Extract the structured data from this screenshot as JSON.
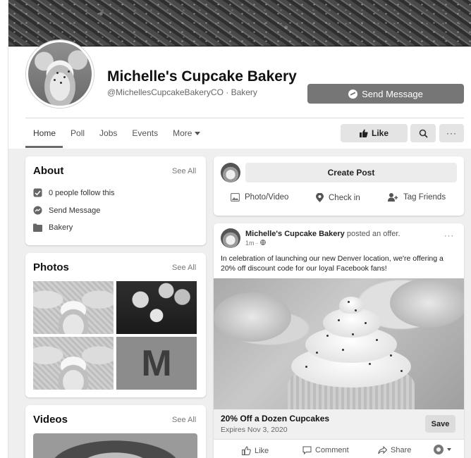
{
  "page": {
    "name": "Michelle's Cupcake Bakery",
    "handle_category": "@MichellesCupcakeBakeryCO · Bakery",
    "send_message": "Send Message"
  },
  "tabs": [
    "Home",
    "Poll",
    "Jobs",
    "Events",
    "More"
  ],
  "actions": {
    "like": "Like",
    "more": "···"
  },
  "about": {
    "title": "About",
    "see_all": "See All",
    "follow": "0 people follow this",
    "message": "Send Message",
    "category": "Bakery"
  },
  "photos": {
    "title": "Photos",
    "see_all": "See All",
    "logo_letter": "M"
  },
  "videos": {
    "title": "Videos",
    "see_all": "See All"
  },
  "composer": {
    "create_post": "Create Post",
    "photo_video": "Photo/Video",
    "check_in": "Check in",
    "tag_friends": "Tag Friends"
  },
  "post": {
    "author": "Michelle's Cupcake Bakery",
    "action": " posted an offer.",
    "time": "1m · ",
    "menu": "···",
    "text": "In celebration of launching our new Denver location, we're offering a 20% off discount code for our loyal Facebook fans!",
    "offer_title": "20% Off a Dozen Cupcakes",
    "offer_expires": "Expires Nov 3, 2020",
    "save": "Save",
    "like": "Like",
    "comment": "Comment",
    "share": "Share"
  }
}
